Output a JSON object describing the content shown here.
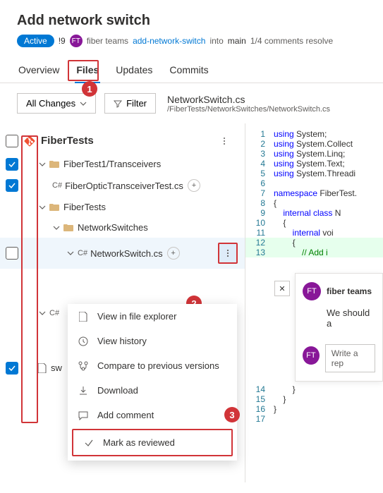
{
  "header": {
    "title": "Add network switch",
    "status_badge": "Active",
    "id": "!9",
    "avatar_initials": "FT",
    "team": "fiber teams",
    "source_branch": "add-network-switch",
    "into": "into",
    "target_branch": "main",
    "comments_status": "1/4 comments resolve"
  },
  "tabs": [
    "Overview",
    "Files",
    "Updates",
    "Commits"
  ],
  "toolbar": {
    "all_changes": "All Changes",
    "filter": "Filter",
    "file_title": "NetworkSwitch.cs",
    "file_path": "/FiberTests/NetworkSwitches/NetworkSwitch.cs"
  },
  "tree": {
    "root_label": "FiberTests",
    "items": [
      {
        "label": "FiberTest1/Transceivers",
        "depth": 1,
        "checked": true,
        "type": "folder"
      },
      {
        "label": "FiberOpticTransceiverTest.cs",
        "depth": 2,
        "checked": true,
        "type": "cs",
        "badge": "+"
      },
      {
        "label": "FiberTests",
        "depth": 1,
        "checked": false,
        "type": "folder"
      },
      {
        "label": "NetworkSwitches",
        "depth": 2,
        "checked": false,
        "type": "folder"
      },
      {
        "label": "NetworkSwitch.cs",
        "depth": 3,
        "checked": false,
        "type": "cs",
        "badge": "+",
        "selected": true
      },
      {
        "label": "",
        "depth": 2,
        "checked": false,
        "type": "cs-hidden"
      },
      {
        "label": "sw",
        "depth": 1,
        "checked": true,
        "type": "file"
      }
    ]
  },
  "menu": {
    "items": [
      "View in file explorer",
      "View history",
      "Compare to previous versions",
      "Download",
      "Add comment",
      "Mark as reviewed"
    ]
  },
  "code": {
    "lines": [
      {
        "n": 1,
        "t": "using System;"
      },
      {
        "n": 2,
        "t": "using System.Collect"
      },
      {
        "n": 3,
        "t": "using System.Linq;"
      },
      {
        "n": 4,
        "t": "using System.Text;"
      },
      {
        "n": 5,
        "t": "using System.Threadi"
      },
      {
        "n": 6,
        "t": ""
      },
      {
        "n": 7,
        "t": "namespace FiberTest."
      },
      {
        "n": 8,
        "t": "{"
      },
      {
        "n": 9,
        "t": "    internal class N"
      },
      {
        "n": 10,
        "t": "    {"
      },
      {
        "n": 11,
        "t": "        internal voi"
      },
      {
        "n": 12,
        "t": "        {",
        "added": true
      },
      {
        "n": 13,
        "t": "            // Add i",
        "added": true
      }
    ],
    "tail": [
      {
        "n": 14,
        "t": "        }"
      },
      {
        "n": 15,
        "t": "    }"
      },
      {
        "n": 16,
        "t": "}"
      },
      {
        "n": 17,
        "t": ""
      }
    ]
  },
  "comment": {
    "author": "fiber teams",
    "body": "We should a",
    "reply_placeholder": "Write a rep"
  }
}
